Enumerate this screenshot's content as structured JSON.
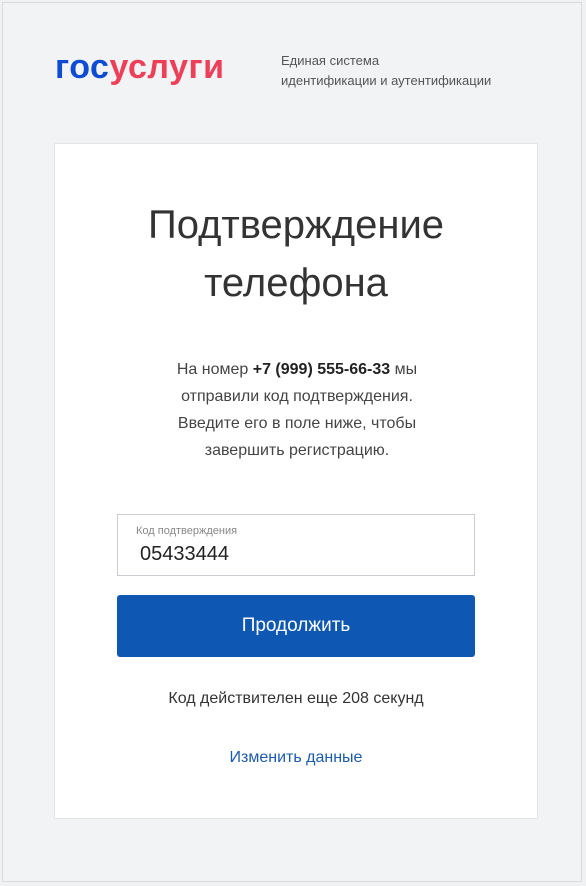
{
  "header": {
    "logo_part1": "гос",
    "logo_part2": "услуги",
    "subtitle_line1": "Единая система",
    "subtitle_line2": "идентификации и аутентификации"
  },
  "card": {
    "title_line1": "Подтверждение",
    "title_line2": "телефона",
    "message_prefix": "На номер ",
    "phone": "+7 (999) 555-66-33",
    "message_suffix": " мы",
    "message_line2": "отправили код подтверждения.",
    "message_line3": "Введите его в поле ниже, чтобы",
    "message_line4": "завершить регистрацию."
  },
  "code_field": {
    "label": "Код подтверждения",
    "value": "05433444"
  },
  "continue_button": {
    "label": "Продолжить"
  },
  "timer_text": "Код действителен еще 208 секунд",
  "change_link": "Изменить данные",
  "colors": {
    "logo_blue": "#0d4cd3",
    "logo_red": "#ee3f58",
    "button_blue": "#0e58b3",
    "link_blue": "#1c5bab"
  }
}
